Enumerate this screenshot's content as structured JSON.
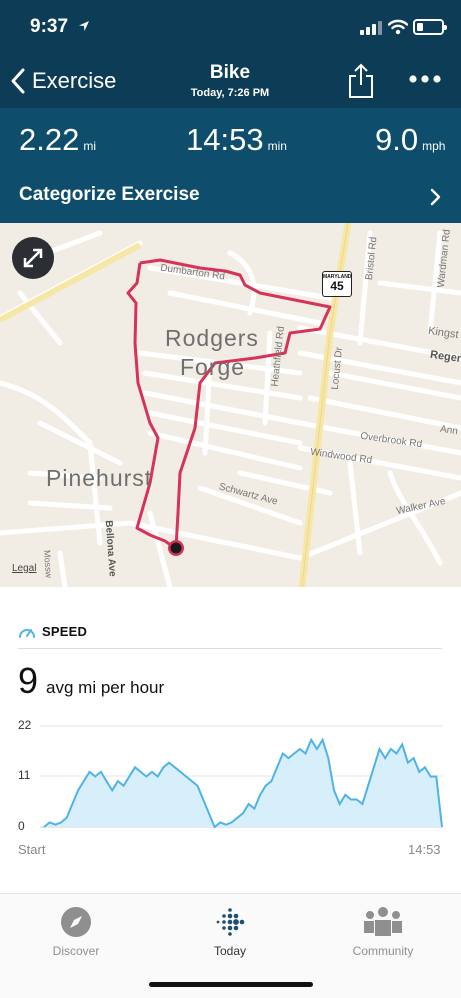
{
  "status_bar": {
    "time": "9:37"
  },
  "header": {
    "back_label": "Exercise",
    "title": "Bike",
    "subtitle": "Today, 7:26 PM"
  },
  "stats": {
    "distance": {
      "value": "2.22",
      "unit": "mi"
    },
    "duration": {
      "value": "14:53",
      "unit": "min"
    },
    "speed": {
      "value": "9.0",
      "unit": "mph"
    }
  },
  "categorize": {
    "label": "Categorize Exercise"
  },
  "map": {
    "legal": "Legal",
    "shield_top": "MARYLAND",
    "shield_number": "45",
    "places": {
      "rodgers": "Rodgers",
      "forge": "Forge",
      "pinehurst": "Pinehurst"
    },
    "roads": {
      "dumbarton": "Dumbarton Rd",
      "bristol": "Bristol Rd",
      "wardman": "Wardman Rd",
      "kingst": "Kingst",
      "regen": "Regen",
      "heathfield": "Heathfield Rd",
      "locust": "Locust Dr",
      "overbrook": "Overbrook Rd",
      "ann": "Ann",
      "windwood": "Windwood Rd",
      "schwartz": "Schwartz Ave",
      "walker": "Walker Ave",
      "bellona": "Bellona Ave",
      "mossw": "Mossw"
    },
    "colors": {
      "route": "#d6325a",
      "land": "#f2ede4",
      "major_road": "#f7e7a6"
    }
  },
  "speed_section": {
    "heading": "SPEED",
    "avg_value": "9",
    "avg_unit": "avg mi per hour"
  },
  "chart_data": {
    "type": "area",
    "ylim": [
      0,
      22
    ],
    "yticks": [
      "22",
      "11",
      "0"
    ],
    "x_start_label": "Start",
    "x_end_label": "14:53",
    "color": "#4fb3e8",
    "fill": "#d7eefb",
    "series": [
      {
        "values": [
          0,
          1,
          0.5,
          1,
          2,
          5,
          8,
          10,
          12,
          11,
          12,
          10,
          8,
          10,
          9,
          11,
          13,
          12,
          11,
          12,
          11,
          13,
          14,
          13,
          12,
          11,
          10,
          9,
          6,
          3,
          0,
          1,
          0.5,
          1,
          2,
          3,
          5,
          4,
          7,
          9,
          10,
          13,
          16,
          15,
          16,
          17,
          16,
          19,
          17,
          19,
          15,
          8,
          5,
          7,
          6,
          6,
          5,
          9,
          13,
          17,
          15,
          17,
          16,
          18,
          14,
          15,
          12,
          13,
          11,
          11,
          0
        ]
      }
    ]
  },
  "tabs": [
    {
      "label": "Discover"
    },
    {
      "label": "Today"
    },
    {
      "label": "Community"
    }
  ]
}
